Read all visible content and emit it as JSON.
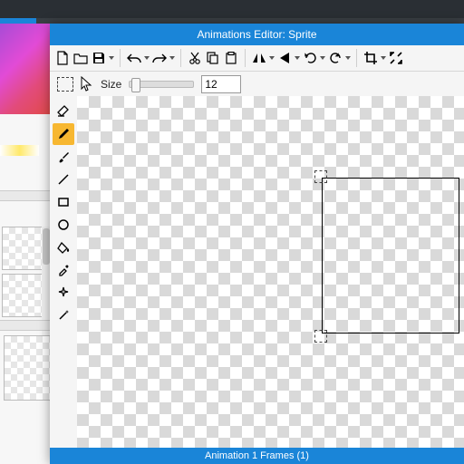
{
  "window": {
    "title": "Animations Editor: Sprite"
  },
  "toolbar": {
    "groups": [
      [
        "new",
        "open",
        "save"
      ],
      [
        "undo",
        "redo"
      ],
      [
        "cut",
        "copy",
        "paste"
      ],
      [
        "flip-h",
        "flip-v",
        "rotate-ccw",
        "rotate-cw"
      ],
      [
        "crop",
        "expand"
      ]
    ]
  },
  "options": {
    "size_label": "Size",
    "size_value": "12"
  },
  "tools": [
    {
      "name": "eraser",
      "selected": false
    },
    {
      "name": "pencil",
      "selected": true
    },
    {
      "name": "brush",
      "selected": false
    },
    {
      "name": "line",
      "selected": false
    },
    {
      "name": "rectangle",
      "selected": false
    },
    {
      "name": "circle",
      "selected": false
    },
    {
      "name": "fill",
      "selected": false
    },
    {
      "name": "eyedropper",
      "selected": false
    },
    {
      "name": "sparkle",
      "selected": false
    },
    {
      "name": "wand",
      "selected": false
    }
  ],
  "footer": {
    "text": "Animation 1 Frames (1)"
  }
}
